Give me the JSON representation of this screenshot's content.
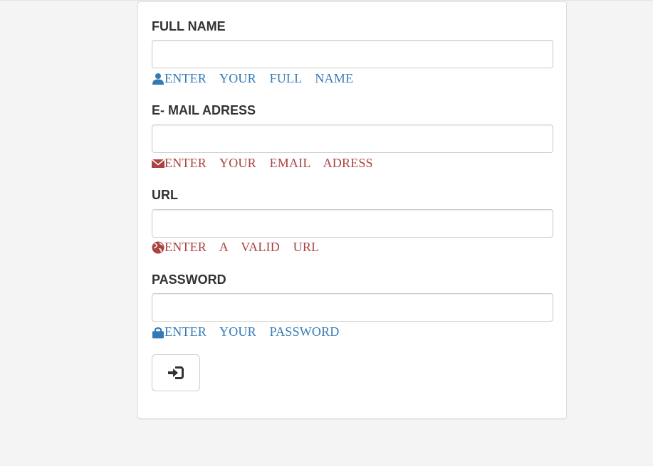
{
  "form": {
    "fields": [
      {
        "label": "FULL NAME",
        "value": "",
        "help_text": "ENTER YOUR FULL NAME",
        "help_icon": "user-icon",
        "help_color": "#337ab7"
      },
      {
        "label": "E- MAIL ADRESS",
        "value": "",
        "help_text": "ENTER YOUR EMAIL ADRESS",
        "help_icon": "envelope-icon",
        "help_color": "#a94442"
      },
      {
        "label": "URL",
        "value": "",
        "help_text": "ENTER A VALID URL",
        "help_icon": "globe-icon",
        "help_color": "#a94442"
      },
      {
        "label": "PASSWORD",
        "value": "",
        "help_text": "ENTER YOUR PASSWORD",
        "help_icon": "lock-icon",
        "help_color": "#337ab7"
      }
    ],
    "submit_icon": "log-in-icon"
  }
}
